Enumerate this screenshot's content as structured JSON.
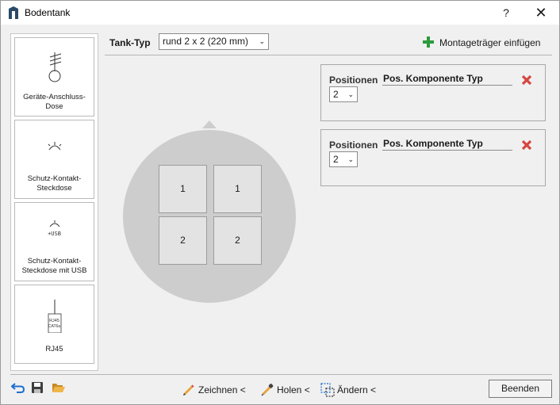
{
  "window": {
    "title": "Bodentank",
    "help": "?",
    "close": "✕"
  },
  "palette": {
    "items": [
      {
        "label": "Geräte-Anschluss-Dose",
        "icon": "device-socket-icon"
      },
      {
        "label": "Schutz-Kontakt-Steckdose",
        "icon": "schuko-outlet-icon"
      },
      {
        "label": "Schutz-Kontakt-Steckdose mit USB",
        "icon": "schuko-usb-outlet-icon",
        "icon_text": "+USB"
      },
      {
        "label": "RJ45",
        "icon": "rj45-socket-icon",
        "icon_text": "RJ45",
        "icon_subtext": "CAT6a"
      }
    ]
  },
  "toolbar": {
    "tank_type_label": "Tank-Typ",
    "tank_type_value": "rund  2 x 2 (220 mm)",
    "add_label": "Montageträger einfügen"
  },
  "tank": {
    "cells": [
      "1",
      "1",
      "2",
      "2"
    ]
  },
  "components": [
    {
      "positions_label": "Positionen",
      "positions_value": "2",
      "field_label": "Pos. Komponente Typ"
    },
    {
      "positions_label": "Positionen",
      "positions_value": "2",
      "field_label": "Pos. Komponente Typ"
    }
  ],
  "bottom": {
    "draw_label": "Zeichnen <",
    "fetch_label": "Holen <",
    "change_label": "Ändern <",
    "end_label": "Beenden"
  },
  "colors": {
    "add_green": "#2e9a3e",
    "delete_red": "#d64541",
    "undo_blue": "#1e6fd0",
    "folder_yellow": "#e8a33c",
    "tank_gray": "#cdcdcd"
  }
}
